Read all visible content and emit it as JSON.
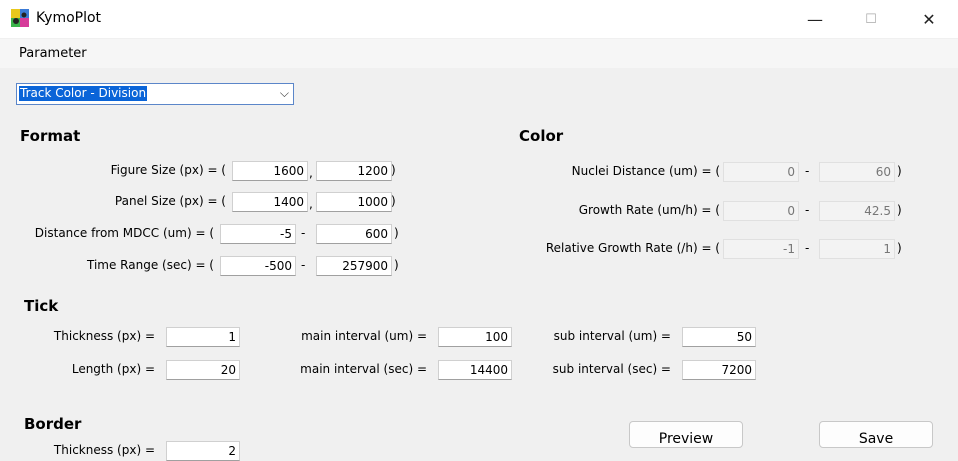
{
  "window": {
    "title": "KymoPlot",
    "minimize": "—",
    "maximize": "☐",
    "close": "✕"
  },
  "menu": {
    "parameter": "Parameter"
  },
  "preset": {
    "selected": "Track Color - Division",
    "chevron": "⌵"
  },
  "format": {
    "heading": "Format",
    "figure_size": {
      "label": "Figure Size (px)  =  (",
      "w": "1600",
      "sep": ",",
      "h": "1200",
      "close": ")"
    },
    "panel_size": {
      "label": "Panel Size (px)  =  (",
      "w": "1400",
      "sep": ",",
      "h": "1000",
      "close": ")"
    },
    "distance": {
      "label": "Distance from MDCC (um)  =  (",
      "min": "-5",
      "sep": "-",
      "max": "600",
      "close": ")"
    },
    "time_range": {
      "label": "Time Range (sec)  =  (",
      "min": "-500",
      "sep": "-",
      "max": "257900",
      "close": ")"
    }
  },
  "color": {
    "heading": "Color",
    "nuclei_distance": {
      "label": "Nuclei Distance (um)  =  (",
      "min": "0",
      "sep": "-",
      "max": "60",
      "close": ")"
    },
    "growth_rate": {
      "label": "Growth Rate (um/h)  =  (",
      "min": "0",
      "sep": "-",
      "max": "42.5",
      "close": ")"
    },
    "relative_growth": {
      "label": "Relative Growth Rate (/h)  =  (",
      "min": "-1",
      "sep": "-",
      "max": "1",
      "close": ")"
    }
  },
  "tick": {
    "heading": "Tick",
    "thickness": {
      "label": "Thickness (px) =",
      "value": "1"
    },
    "length": {
      "label": "Length (px) =",
      "value": "20"
    },
    "main_um": {
      "label": "main interval (um) =",
      "value": "100"
    },
    "main_sec": {
      "label": "main interval (sec) =",
      "value": "14400"
    },
    "sub_um": {
      "label": "sub interval (um) =",
      "value": "50"
    },
    "sub_sec": {
      "label": "sub interval (sec) =",
      "value": "7200"
    }
  },
  "border": {
    "heading": "Border",
    "thickness_label": "Thickness (px) =",
    "thickness_value": "2"
  },
  "buttons": {
    "preview": "Preview",
    "save": "Save"
  },
  "colors": {
    "selection": "#0a64d8",
    "dropdown_border": "#5b86c9",
    "window_bg": "#f0f0f0"
  }
}
